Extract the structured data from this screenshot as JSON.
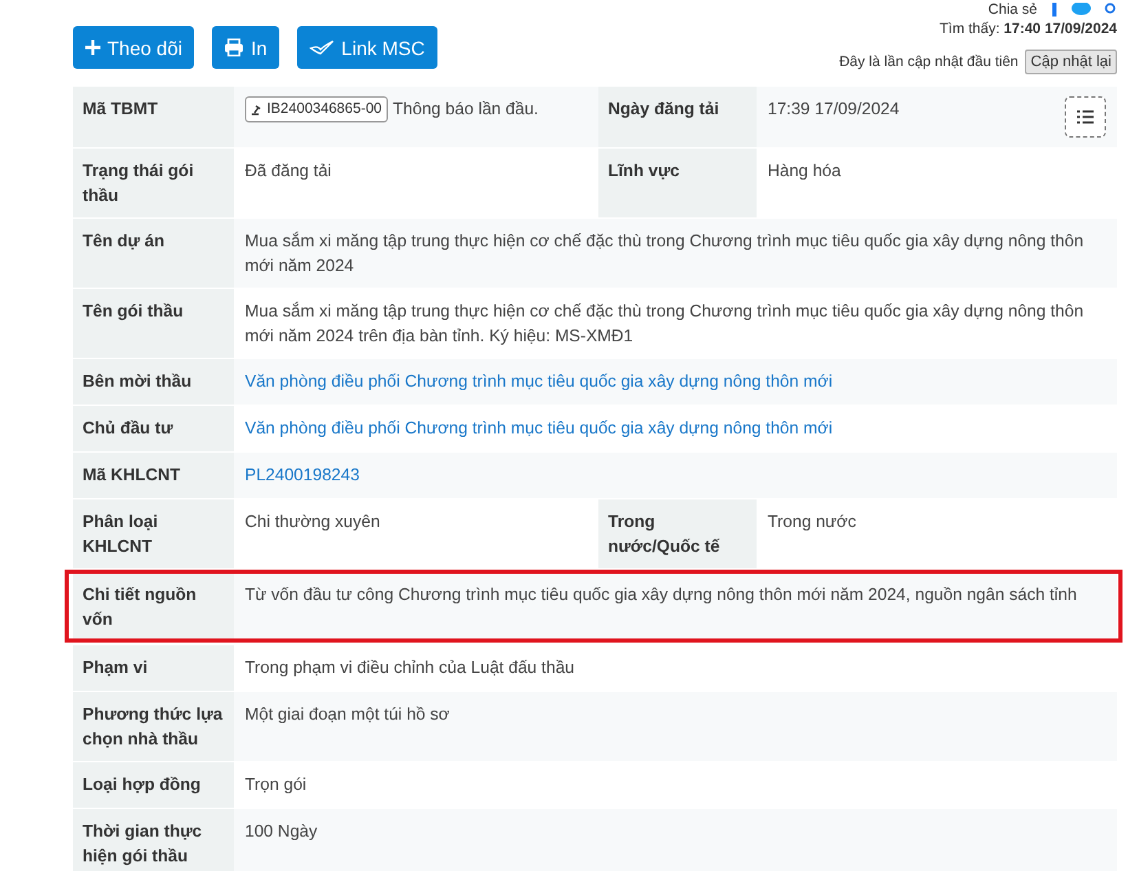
{
  "share": {
    "label": "Chia sẻ"
  },
  "actions": [
    {
      "label": "Theo dõi",
      "kind": "follow"
    },
    {
      "label": "In",
      "kind": "print"
    },
    {
      "label": "Link MSC",
      "kind": "msc"
    }
  ],
  "found": "Tìm thấy: **17:40 17/09/2024**",
  "update_note": "Đây là lần cập nhật đầu tiên",
  "update_button": "Cập nhật lại",
  "rows": [
    {
      "label": "Mã TBMT",
      "kind": "badge",
      "badge": "IB2400346865-00",
      "value": "Thông báo lần đầu.",
      "label2": "Ngày đăng tải",
      "value2": "17:39 17/09/2024",
      "highlighted": false
    },
    {
      "label": "Trạng thái gói thầu",
      "kind": "text",
      "value": "Đã đăng tải",
      "label2": "Lĩnh vực",
      "value2": "Hàng hóa",
      "highlighted": false
    },
    {
      "label": "Tên dự án",
      "kind": "text",
      "value": "Mua sắm xi măng tập trung thực hiện cơ chế đặc thù trong Chương trình mục tiêu quốc gia xây dựng nông thôn mới năm 2024",
      "highlighted": false
    },
    {
      "label": "Tên gói thầu",
      "kind": "text",
      "value": "Mua sắm xi măng tập trung thực hiện cơ chế đặc thù trong Chương trình mục tiêu quốc gia xây dựng nông thôn mới năm 2024 trên địa bàn tỉnh. Ký hiệu: MS-XMĐ1",
      "highlighted": false
    },
    {
      "label": "Bên mời thầu",
      "kind": "link",
      "value": "Văn phòng điều phối Chương trình mục tiêu quốc gia xây dựng nông thôn mới",
      "highlighted": false
    },
    {
      "label": "Chủ đầu tư",
      "kind": "link",
      "value": "Văn phòng điều phối Chương trình mục tiêu quốc gia xây dựng nông thôn mới",
      "highlighted": false
    },
    {
      "label": "Mã KHLCNT",
      "kind": "link",
      "value": "PL2400198243",
      "highlighted": false
    },
    {
      "label": "Phân loại KHLCNT",
      "kind": "text",
      "value": "Chi thường xuyên",
      "label2": "Trong nước/Quốc tế",
      "value2": "Trong nước",
      "highlighted": false
    },
    {
      "label": "Chi tiết nguồn vốn",
      "kind": "text",
      "value": "Từ vốn đầu tư công Chương trình mục tiêu quốc gia xây dựng nông thôn mới năm 2024, nguồn ngân sách tỉnh",
      "highlighted": true
    },
    {
      "label": "Phạm vi",
      "kind": "text",
      "value": "Trong phạm vi điều chỉnh của Luật đấu thầu",
      "highlighted": false
    },
    {
      "label": "Phương thức lựa chọn nhà thầu",
      "kind": "text",
      "value": "Một giai đoạn một túi hồ sơ",
      "highlighted": false
    },
    {
      "label": "Loại hợp đồng",
      "kind": "text",
      "value": "Trọn gói",
      "highlighted": false
    },
    {
      "label": "Thời gian thực hiện gói thầu",
      "kind": "text",
      "value": "100 Ngày",
      "highlighted": false
    }
  ]
}
